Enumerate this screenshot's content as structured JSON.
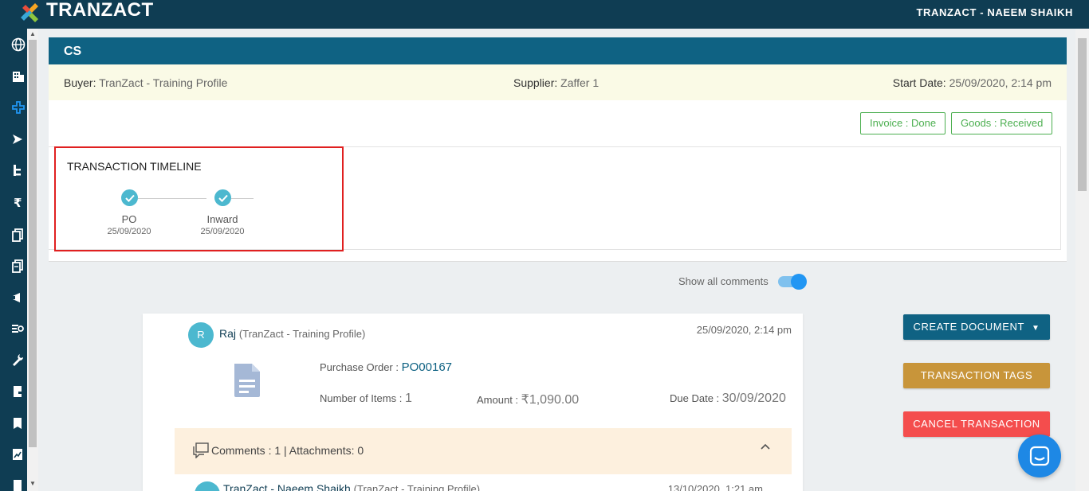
{
  "brand": {
    "logo_text": "TRANZACT"
  },
  "header": {
    "user": "TRANZACT - NAEEM SHAIKH"
  },
  "nav": {
    "icons": [
      "globe-icon",
      "building-icon",
      "add-icon",
      "send-icon",
      "hierarchy-icon",
      "rupee-icon",
      "documents-icon",
      "documents-alt-icon",
      "megaphone-icon",
      "receipt-icon",
      "wrench-icon",
      "inventory-icon",
      "book-icon",
      "chart-icon",
      "more-icon"
    ]
  },
  "transaction": {
    "title": "CS",
    "buyer_label": "Buyer:",
    "buyer": "TranZact - Training Profile",
    "supplier_label": "Supplier:",
    "supplier": "Zaffer 1",
    "start_label": "Start Date:",
    "start_date": "25/09/2020, 2:14 pm",
    "status": {
      "invoice": "Invoice : Done",
      "goods": "Goods : Received"
    },
    "status_color": "#4caf50"
  },
  "timeline": {
    "title": "TRANSACTION TIMELINE",
    "steps": [
      {
        "label": "PO",
        "date": "25/09/2020"
      },
      {
        "label": "Inward",
        "date": "25/09/2020"
      }
    ]
  },
  "feed": {
    "show_comments_label": "Show all comments",
    "show_comments_on": true,
    "posts": [
      {
        "avatar_initial": "R",
        "author": "Raj",
        "org": "(TranZact - Training Profile)",
        "time": "25/09/2020, 2:14 pm",
        "doc_label": "Purchase Order :",
        "doc_number": "PO00167",
        "items_label": "Number of Items :",
        "items": "1",
        "amount_label": "Amount :",
        "amount": "₹1,090.00",
        "due_label": "Due Date :",
        "due_date": "30/09/2020",
        "comments_summary": "Comments : 1 | Attachments: 0"
      },
      {
        "author": "TranZact - Naeem Shaikh",
        "org": "(TranZact - Training Profile)",
        "time": "13/10/2020, 1:21 am"
      }
    ]
  },
  "actions": {
    "create": "CREATE DOCUMENT",
    "tags": "TRANSACTION TAGS",
    "cancel": "CANCEL TRANSACTION"
  },
  "colors": {
    "primary": "#0f6283",
    "nav_bg": "#0f3d53",
    "tags": "#c8953a",
    "cancel": "#f44d4d",
    "accent": "#4cb8cf"
  }
}
